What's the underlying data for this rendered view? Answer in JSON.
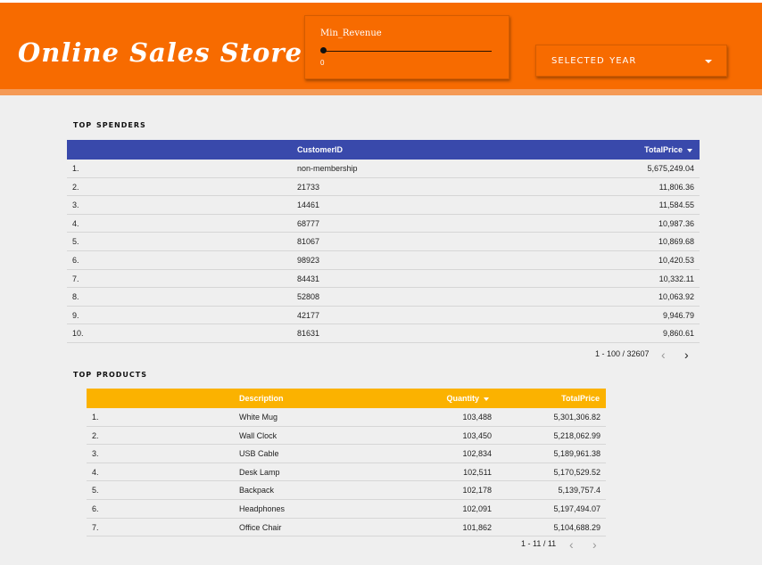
{
  "header": {
    "title": "Online Sales Store",
    "accent": "#f76b00"
  },
  "slider": {
    "label": "Min_Revenue",
    "value": "0"
  },
  "year_select": {
    "label": "selected year",
    "icon": "chevron-down-icon"
  },
  "top_spenders": {
    "title": "top spenders",
    "header_color": "#3949ab",
    "columns": [
      "",
      "CustomerID",
      "TotalPrice"
    ],
    "rows": [
      [
        "1.",
        "non-membership",
        "5,675,249.04"
      ],
      [
        "2.",
        "21733",
        "11,806.36"
      ],
      [
        "3.",
        "14461",
        "11,584.55"
      ],
      [
        "4.",
        "68777",
        "10,987.36"
      ],
      [
        "5.",
        "81067",
        "10,869.68"
      ],
      [
        "6.",
        "98923",
        "10,420.53"
      ],
      [
        "7.",
        "84431",
        "10,332.11"
      ],
      [
        "8.",
        "52808",
        "10,063.92"
      ],
      [
        "9.",
        "42177",
        "9,946.79"
      ],
      [
        "10.",
        "81631",
        "9,860.61"
      ]
    ],
    "pagination": "1 - 100 / 32607",
    "prev": "‹",
    "next": "›"
  },
  "top_products": {
    "title": "top products",
    "header_color": "#fbb200",
    "columns": [
      "",
      "Description",
      "Quantity",
      "TotalPrice"
    ],
    "rows": [
      [
        "1.",
        "White Mug",
        "103,488",
        "5,301,306.82"
      ],
      [
        "2.",
        "Wall Clock",
        "103,450",
        "5,218,062.99"
      ],
      [
        "3.",
        "USB Cable",
        "102,834",
        "5,189,961.38"
      ],
      [
        "4.",
        "Desk Lamp",
        "102,511",
        "5,170,529.52"
      ],
      [
        "5.",
        "Backpack",
        "102,178",
        "5,139,757.4"
      ],
      [
        "6.",
        "Headphones",
        "102,091",
        "5,197,494.07"
      ],
      [
        "7.",
        "Office Chair",
        "101,862",
        "5,104,688.29"
      ]
    ],
    "pagination": "1 - 11 / 11",
    "prev": "‹",
    "next": "›"
  }
}
